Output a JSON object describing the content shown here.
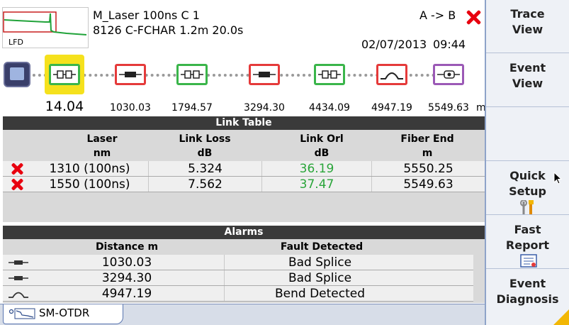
{
  "header": {
    "thumb_label": "LFD",
    "line1": "M_Laser  100ns  C  1",
    "line2": "8126 C-FCHAR   1.2m  20.0s",
    "direction": "A -> B",
    "date": "02/07/2013",
    "time": "09:44",
    "status_icon": "fail-x-icon"
  },
  "diagram": {
    "unit": "m",
    "events": [
      {
        "label": "14.04",
        "kind": "connector",
        "color": "#3ab54a",
        "selected": true
      },
      {
        "label": "1030.03",
        "kind": "splice",
        "color": "#e53a3a"
      },
      {
        "label": "1794.57",
        "kind": "connector",
        "color": "#3ab54a"
      },
      {
        "label": "3294.30",
        "kind": "splice",
        "color": "#e53a3a"
      },
      {
        "label": "4434.09",
        "kind": "connector",
        "color": "#3ab54a"
      },
      {
        "label": "4947.19",
        "kind": "bend",
        "color": "#e53a3a"
      },
      {
        "label": "5549.63",
        "kind": "fiber-end",
        "color": "#9b59b6"
      }
    ]
  },
  "link_table": {
    "title": "Link Table",
    "columns": [
      {
        "name": "Laser",
        "unit": "nm"
      },
      {
        "name": "Link Loss",
        "unit": "dB"
      },
      {
        "name": "Link Orl",
        "unit": "dB"
      },
      {
        "name": "Fiber End",
        "unit": "m"
      }
    ],
    "rows": [
      {
        "laser": "1310 (100ns)",
        "loss": "5.324",
        "orl": "36.19",
        "end": "5550.25"
      },
      {
        "laser": "1550 (100ns)",
        "loss": "7.562",
        "orl": "37.47",
        "end": "5549.63"
      }
    ]
  },
  "alarms": {
    "title": "Alarms",
    "columns": [
      "Distance m",
      "Fault Detected"
    ],
    "rows": [
      {
        "distance": "1030.03",
        "fault": "Bad Splice",
        "icon": "splice-icon"
      },
      {
        "distance": "3294.30",
        "fault": "Bad Splice",
        "icon": "splice-icon"
      },
      {
        "distance": "4947.19",
        "fault": "Bend Detected",
        "icon": "bend-icon"
      }
    ]
  },
  "tabs": [
    {
      "label": "SM-OTDR",
      "active": true
    }
  ],
  "softkeys": [
    {
      "l1": "Trace",
      "l2": "View"
    },
    {
      "l1": "Event",
      "l2": "View"
    },
    {
      "l1": "",
      "l2": ""
    },
    {
      "l1": "Quick",
      "l2": "Setup",
      "icon": "tools-icon"
    },
    {
      "l1": "Fast",
      "l2": "Report",
      "icon": "report-icon"
    },
    {
      "l1": "Event",
      "l2": "Diagnosis"
    }
  ],
  "colors": {
    "pass": "#3ab54a",
    "fail": "#e53a3a",
    "fiber_end": "#9b59b6",
    "selection": "#f5e11d",
    "orl_value": "#2aa53a"
  }
}
